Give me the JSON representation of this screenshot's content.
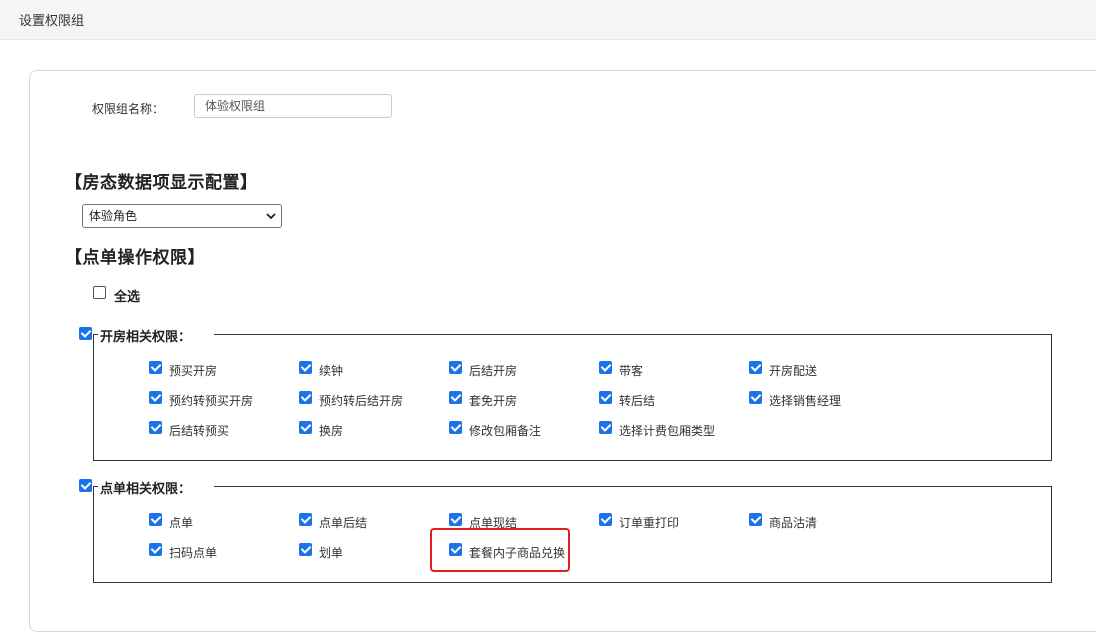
{
  "page": {
    "title": "设置权限组"
  },
  "form": {
    "name_label": "权限组名称：",
    "name_value": "体验权限组"
  },
  "room_display": {
    "section_title": "【房态数据项显示配置】",
    "select_value": "体验角色"
  },
  "order_perm": {
    "section_title": "【点单操作权限】",
    "select_all_label": "全选",
    "select_all_checked": false
  },
  "group_open": {
    "title": "开房相关权限：",
    "checked": true,
    "items": [
      "预买开房",
      "续钟",
      "后结开房",
      "带客",
      "开房配送",
      "预约转预买开房",
      "预约转后结开房",
      "套免开房",
      "转后结",
      "选择销售经理",
      "后结转预买",
      "换房",
      "修改包厢备注",
      "选择计费包厢类型"
    ],
    "checked_states": [
      true,
      true,
      true,
      true,
      true,
      true,
      true,
      true,
      true,
      true,
      true,
      true,
      true,
      true
    ]
  },
  "group_order": {
    "title": "点单相关权限：",
    "checked": true,
    "items": [
      "点单",
      "点单后结",
      "点单现结",
      "订单重打印",
      "商品沽清",
      "扫码点单",
      "划单",
      "套餐内子商品兑换"
    ],
    "checked_states": [
      true,
      true,
      true,
      true,
      true,
      true,
      true,
      true
    ]
  },
  "colors": {
    "checkbox": "#1a73e8",
    "highlight": "#e02020"
  }
}
